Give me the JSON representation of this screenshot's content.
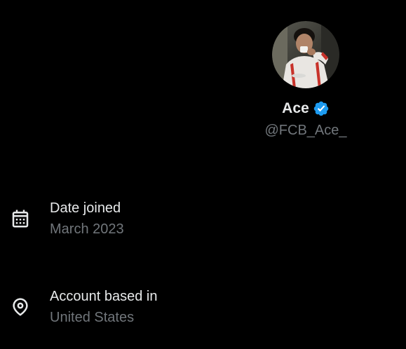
{
  "profile": {
    "display_name": "Ace",
    "handle": "@FCB_Ace_",
    "verified": true,
    "avatar_alt": "Ace"
  },
  "about": {
    "date_joined": {
      "icon": "calendar-icon",
      "label": "Date joined",
      "value": "March 2023"
    },
    "account_location": {
      "icon": "location-pin-icon",
      "label": "Account based in",
      "value": "United States"
    }
  },
  "colors": {
    "background": "#000000",
    "primary_text": "#e7e9ea",
    "secondary_text": "#71767b",
    "verified_badge": "#1d9bf0"
  }
}
